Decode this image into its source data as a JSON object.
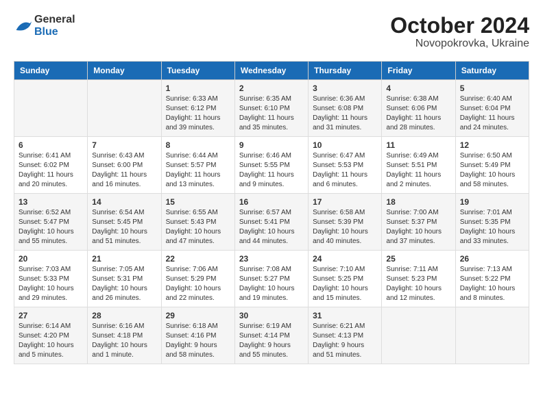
{
  "logo": {
    "general": "General",
    "blue": "Blue"
  },
  "header": {
    "month_year": "October 2024",
    "location": "Novopokrovka, Ukraine"
  },
  "weekdays": [
    "Sunday",
    "Monday",
    "Tuesday",
    "Wednesday",
    "Thursday",
    "Friday",
    "Saturday"
  ],
  "weeks": [
    [
      {
        "day": "",
        "info": ""
      },
      {
        "day": "",
        "info": ""
      },
      {
        "day": "1",
        "info": "Sunrise: 6:33 AM\nSunset: 6:12 PM\nDaylight: 11 hours and 39 minutes."
      },
      {
        "day": "2",
        "info": "Sunrise: 6:35 AM\nSunset: 6:10 PM\nDaylight: 11 hours and 35 minutes."
      },
      {
        "day": "3",
        "info": "Sunrise: 6:36 AM\nSunset: 6:08 PM\nDaylight: 11 hours and 31 minutes."
      },
      {
        "day": "4",
        "info": "Sunrise: 6:38 AM\nSunset: 6:06 PM\nDaylight: 11 hours and 28 minutes."
      },
      {
        "day": "5",
        "info": "Sunrise: 6:40 AM\nSunset: 6:04 PM\nDaylight: 11 hours and 24 minutes."
      }
    ],
    [
      {
        "day": "6",
        "info": "Sunrise: 6:41 AM\nSunset: 6:02 PM\nDaylight: 11 hours and 20 minutes."
      },
      {
        "day": "7",
        "info": "Sunrise: 6:43 AM\nSunset: 6:00 PM\nDaylight: 11 hours and 16 minutes."
      },
      {
        "day": "8",
        "info": "Sunrise: 6:44 AM\nSunset: 5:57 PM\nDaylight: 11 hours and 13 minutes."
      },
      {
        "day": "9",
        "info": "Sunrise: 6:46 AM\nSunset: 5:55 PM\nDaylight: 11 hours and 9 minutes."
      },
      {
        "day": "10",
        "info": "Sunrise: 6:47 AM\nSunset: 5:53 PM\nDaylight: 11 hours and 6 minutes."
      },
      {
        "day": "11",
        "info": "Sunrise: 6:49 AM\nSunset: 5:51 PM\nDaylight: 11 hours and 2 minutes."
      },
      {
        "day": "12",
        "info": "Sunrise: 6:50 AM\nSunset: 5:49 PM\nDaylight: 10 hours and 58 minutes."
      }
    ],
    [
      {
        "day": "13",
        "info": "Sunrise: 6:52 AM\nSunset: 5:47 PM\nDaylight: 10 hours and 55 minutes."
      },
      {
        "day": "14",
        "info": "Sunrise: 6:54 AM\nSunset: 5:45 PM\nDaylight: 10 hours and 51 minutes."
      },
      {
        "day": "15",
        "info": "Sunrise: 6:55 AM\nSunset: 5:43 PM\nDaylight: 10 hours and 47 minutes."
      },
      {
        "day": "16",
        "info": "Sunrise: 6:57 AM\nSunset: 5:41 PM\nDaylight: 10 hours and 44 minutes."
      },
      {
        "day": "17",
        "info": "Sunrise: 6:58 AM\nSunset: 5:39 PM\nDaylight: 10 hours and 40 minutes."
      },
      {
        "day": "18",
        "info": "Sunrise: 7:00 AM\nSunset: 5:37 PM\nDaylight: 10 hours and 37 minutes."
      },
      {
        "day": "19",
        "info": "Sunrise: 7:01 AM\nSunset: 5:35 PM\nDaylight: 10 hours and 33 minutes."
      }
    ],
    [
      {
        "day": "20",
        "info": "Sunrise: 7:03 AM\nSunset: 5:33 PM\nDaylight: 10 hours and 29 minutes."
      },
      {
        "day": "21",
        "info": "Sunrise: 7:05 AM\nSunset: 5:31 PM\nDaylight: 10 hours and 26 minutes."
      },
      {
        "day": "22",
        "info": "Sunrise: 7:06 AM\nSunset: 5:29 PM\nDaylight: 10 hours and 22 minutes."
      },
      {
        "day": "23",
        "info": "Sunrise: 7:08 AM\nSunset: 5:27 PM\nDaylight: 10 hours and 19 minutes."
      },
      {
        "day": "24",
        "info": "Sunrise: 7:10 AM\nSunset: 5:25 PM\nDaylight: 10 hours and 15 minutes."
      },
      {
        "day": "25",
        "info": "Sunrise: 7:11 AM\nSunset: 5:23 PM\nDaylight: 10 hours and 12 minutes."
      },
      {
        "day": "26",
        "info": "Sunrise: 7:13 AM\nSunset: 5:22 PM\nDaylight: 10 hours and 8 minutes."
      }
    ],
    [
      {
        "day": "27",
        "info": "Sunrise: 6:14 AM\nSunset: 4:20 PM\nDaylight: 10 hours and 5 minutes."
      },
      {
        "day": "28",
        "info": "Sunrise: 6:16 AM\nSunset: 4:18 PM\nDaylight: 10 hours and 1 minute."
      },
      {
        "day": "29",
        "info": "Sunrise: 6:18 AM\nSunset: 4:16 PM\nDaylight: 9 hours and 58 minutes."
      },
      {
        "day": "30",
        "info": "Sunrise: 6:19 AM\nSunset: 4:14 PM\nDaylight: 9 hours and 55 minutes."
      },
      {
        "day": "31",
        "info": "Sunrise: 6:21 AM\nSunset: 4:13 PM\nDaylight: 9 hours and 51 minutes."
      },
      {
        "day": "",
        "info": ""
      },
      {
        "day": "",
        "info": ""
      }
    ]
  ]
}
